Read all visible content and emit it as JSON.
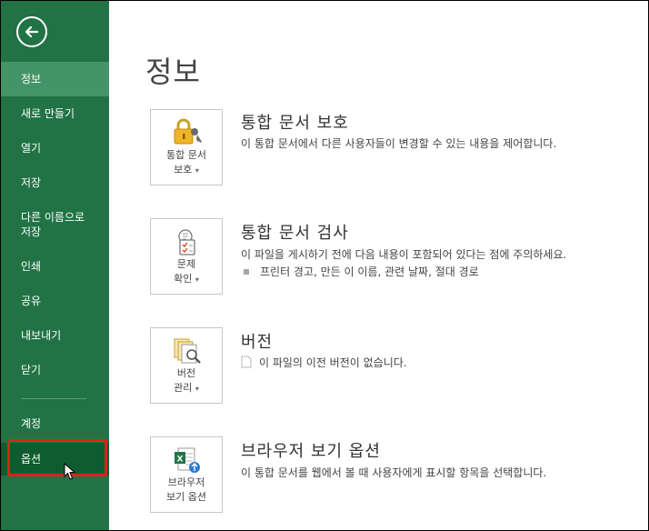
{
  "sidebar": {
    "items": [
      {
        "label": "정보"
      },
      {
        "label": "새로 만들기"
      },
      {
        "label": "열기"
      },
      {
        "label": "저장"
      },
      {
        "label": "다른 이름으로\n저장"
      },
      {
        "label": "인쇄"
      },
      {
        "label": "공유"
      },
      {
        "label": "내보내기"
      },
      {
        "label": "닫기"
      },
      {
        "label": "계정"
      },
      {
        "label": "옵션"
      }
    ],
    "selected": "정보",
    "highlighted": "옵션"
  },
  "main": {
    "title": "정보",
    "sections": [
      {
        "tile_line1": "통합 문서",
        "tile_line2": "보호",
        "title": "통합 문서 보호",
        "desc": "이 통합 문서에서 다른 사용자들이 변경할 수 있는 내용을 제어합니다."
      },
      {
        "tile_line1": "문제",
        "tile_line2": "확인",
        "title": "통합 문서 검사",
        "desc": "이 파일을 게시하기 전에 다음 내용이 포함되어 있다는 점에 주의하세요.",
        "bullet": "프린터 경고, 만든 이 이름, 관련 날짜, 절대 경로"
      },
      {
        "tile_line1": "버전",
        "tile_line2": "관리",
        "title": "버전",
        "desc": "이 파일의 이전 버전이 없습니다."
      },
      {
        "tile_line1": "브라우저",
        "tile_line2": "보기 옵션",
        "title": "브라우저 보기 옵션",
        "desc": "이 통합 문서를 웹에서 볼 때 사용자에게 표시할 항목을 선택합니다."
      }
    ]
  },
  "colors": {
    "sidebar_bg": "#217346",
    "selected_bg": "#439467",
    "highlight_border": "#e0201b"
  },
  "icons": [
    "back-arrow-icon",
    "lock-key-icon",
    "inspect-checklist-icon",
    "versions-search-icon",
    "excel-globe-icon",
    "mouse-pointer-icon"
  ]
}
